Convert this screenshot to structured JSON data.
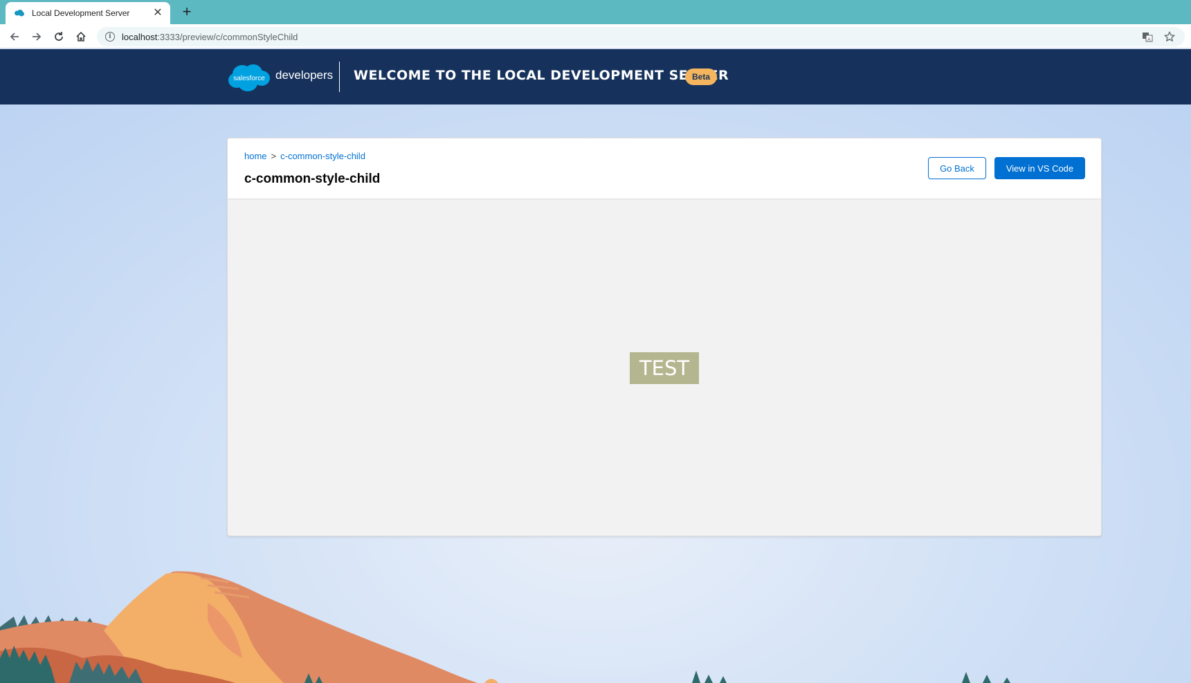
{
  "browser": {
    "tab_title": "Local Development Server",
    "url_host": "localhost",
    "url_path": ":3333/preview/c/commonStyleChild",
    "icons": [
      "back-icon",
      "forward-icon",
      "reload-icon",
      "home-icon",
      "info-icon",
      "translate-icon",
      "star-icon",
      "close-icon",
      "plus-icon"
    ]
  },
  "header": {
    "logo_text": "salesforce",
    "brand_suffix": "developers",
    "title": "WELCOME TO THE LOCAL DEVELOPMENT SERVER",
    "badge": "Beta"
  },
  "card": {
    "breadcrumb": [
      "home",
      ">",
      "c-common-style-child"
    ],
    "title": "c-common-style-child",
    "go_back": "Go Back",
    "view_vscode": "View in VS Code",
    "preview_text": "TEST"
  },
  "colors": {
    "tabbar": "#5cb8c1",
    "header_bg": "#16325c",
    "brand_blue": "#0070d2",
    "badge": "#f4b55e",
    "test_box": "#b4b68f"
  }
}
